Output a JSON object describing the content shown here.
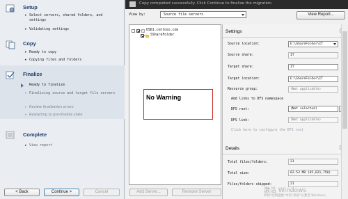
{
  "colors": {
    "accent": "#1f3c6b",
    "warning_border": "#c9312c",
    "topbar": "#2b2b2b"
  },
  "wizard": {
    "sections": [
      {
        "title": "Setup",
        "icon": "gear-icon",
        "steps": [
          {
            "text": "Select servers, shared folders, and settings",
            "state": "done"
          },
          {
            "text": "Validating settings",
            "state": "done"
          }
        ]
      },
      {
        "title": "Copy",
        "icon": "copy-icon",
        "steps": [
          {
            "text": "Ready to copy",
            "state": "done"
          },
          {
            "text": "Copying files and folders",
            "state": "done"
          }
        ]
      },
      {
        "title": "Finalize",
        "icon": "finalize-icon",
        "steps": [
          {
            "text": "Ready to finalize",
            "state": "current"
          },
          {
            "text": "Finalizing source and target file servers",
            "state": "pending"
          },
          {
            "text": "Review finalization errors",
            "state": "disabled"
          },
          {
            "text": "Restarting to pre-finalize state",
            "state": "disabled"
          }
        ]
      },
      {
        "title": "Complete",
        "icon": "complete-icon",
        "steps": [
          {
            "text": "View report",
            "state": "pending"
          }
        ]
      }
    ],
    "buttons": {
      "back": "< Back",
      "continue": "Continue >",
      "cancel": "Cancel"
    }
  },
  "topbar": {
    "text": "Copy completed successfully. Click Continue to finalize the migration."
  },
  "view": {
    "label": "View by:",
    "selected": "Source file servers",
    "report_button": "View Report..."
  },
  "tree": {
    "server": "OSD1.contoso.com",
    "share": "SShareFolder"
  },
  "overlay": {
    "text": "No Warning"
  },
  "tree_buttons": {
    "add": "Add Server...",
    "remove": "Remove Server"
  },
  "settings": {
    "header": "Settings",
    "source_location_label": "Source location:",
    "source_location": "E:\\ShareFolder\\IT",
    "source_share_label": "Source share:",
    "source_share": "IT",
    "target_share_label": "Target share:",
    "target_share": "IT",
    "target_location_label": "Target location:",
    "target_location": "E:\\ShareFolder\\IT",
    "resource_group_label": "Resource group:",
    "resource_group": "(Not applicable)",
    "dfs_header": "Add links to DFS namespace",
    "dfs_root_label": "DFS root:",
    "dfs_root": "(Not selected)",
    "dfs_link_label": "DFS link:",
    "dfs_link": "(Not applicable)",
    "dfs_hint": "Click here to configure the DFS root"
  },
  "details": {
    "header": "Details",
    "total_files_label": "Total files/folders:",
    "total_files": "21",
    "total_size_label": "Total size:",
    "total_size": "62.53 MB (65,621,750)",
    "files_skipped_label": "Files/folders skipped:",
    "files_skipped": "21"
  },
  "watermark": {
    "line1": "激活 Windows",
    "line2": "转到\"控制面板\"中的\"系统\"以激活 Windows。"
  }
}
